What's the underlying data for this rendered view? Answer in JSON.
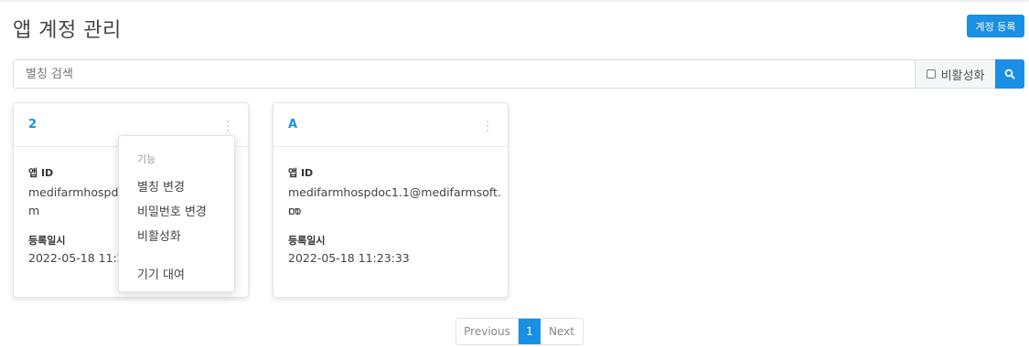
{
  "header": {
    "title": "앱 계정 관리",
    "register_label": "계정 등록"
  },
  "search": {
    "placeholder": "별칭 검색",
    "inactive_label": "비활성화"
  },
  "cards": [
    {
      "title": "2",
      "app_id_label": "앱 ID",
      "app_id_value": "medifarmhospdoc",
      "app_id_value_line2": "m",
      "reg_date_label": "등록일시",
      "reg_date_value": "2022-05-18 11:25"
    },
    {
      "title": "A",
      "app_id_label": "앱 ID",
      "app_id_value": "medifarmhospdoc1.1@medifarmsoft.co",
      "app_id_value_line2": "m",
      "reg_date_label": "등록일시",
      "reg_date_value": "2022-05-18 11:23:33"
    }
  ],
  "context_menu": {
    "header": "기능",
    "items": [
      "별칭 변경",
      "비밀번호 변경",
      "비활성화",
      "기기 대여"
    ]
  },
  "pagination": {
    "previous": "Previous",
    "current": "1",
    "next": "Next"
  },
  "colors": {
    "accent": "#1a8fe3"
  },
  "icons": {
    "search": "search-icon",
    "more": "kebab-menu-icon"
  }
}
